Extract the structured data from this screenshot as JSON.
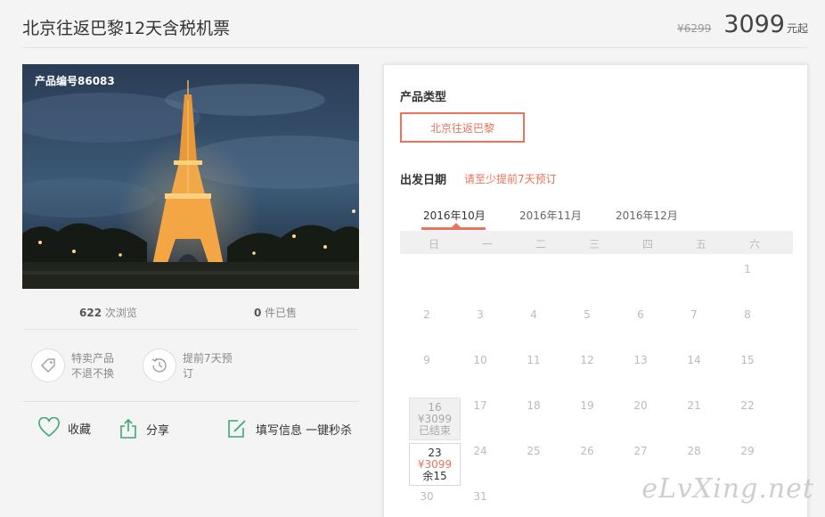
{
  "header": {
    "title": "北京往返巴黎12天含税机票",
    "old_price": "¥6299",
    "price": "3099",
    "price_unit": "元起"
  },
  "photo": {
    "product_code": "产品编号86083"
  },
  "stats": {
    "views_count": "622",
    "views_label": " 次浏览",
    "sold_count": "0",
    "sold_label": " 件已售"
  },
  "features": [
    {
      "icon": "tag-icon",
      "line1": "特卖产品",
      "line2": "不退不换"
    },
    {
      "icon": "clock-history-icon",
      "line1": "提前7天预",
      "line2": "订"
    }
  ],
  "actions": {
    "favorite": "收藏",
    "share": "分享",
    "fill_info": "填写信息 一键秒杀"
  },
  "panel": {
    "type_label": "产品类型",
    "type_option": "北京往返巴黎",
    "date_label": "出发日期",
    "date_hint": "请至少提前7天预订",
    "months": [
      "2016年10月",
      "2016年11月",
      "2016年12月"
    ],
    "weekdays": [
      "日",
      "一",
      "二",
      "三",
      "四",
      "五",
      "六"
    ],
    "ended_day": {
      "day": "16",
      "price": "¥3099",
      "status": "已结束"
    },
    "available_day": {
      "day": "23",
      "price": "¥3099",
      "status": "余15"
    }
  },
  "watermark": "eLvXing.net",
  "colors": {
    "accent": "#e8735e",
    "icon_green": "#3aa876"
  }
}
